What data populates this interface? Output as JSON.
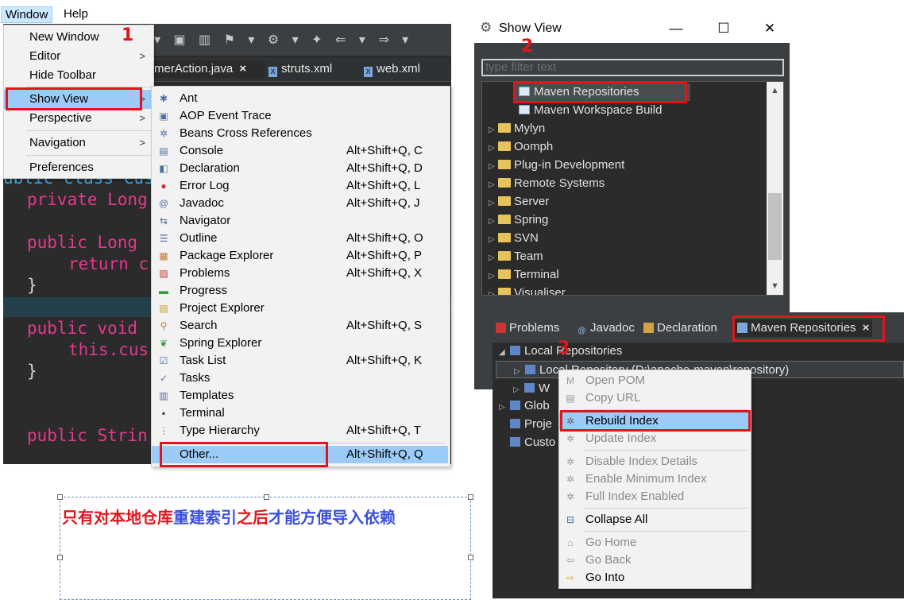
{
  "menubar": {
    "window": "Window",
    "help": "Help"
  },
  "window_menu": {
    "items": [
      {
        "label": "New Window"
      },
      {
        "label": "Editor",
        "submenu": true
      },
      {
        "label": "Hide Toolbar"
      },
      {
        "label": "Show View",
        "submenu": true,
        "selected": true
      },
      {
        "label": "Perspective",
        "submenu": true
      },
      {
        "label": "Navigation",
        "submenu": true
      },
      {
        "label": "Preferences"
      }
    ]
  },
  "editor": {
    "tabs": [
      "merAction.java",
      "struts.xml",
      "web.xml"
    ],
    "tab_close": "×",
    "code_lines": [
      "ublic class Cus",
      "private Long",
      "public Long",
      "return c",
      "}",
      "public void",
      "this.cus",
      "}",
      "public Strin"
    ]
  },
  "show_view_menu": {
    "items": [
      {
        "icon": "ant-icon",
        "glyph": "✱",
        "label": "Ant",
        "shortcut": ""
      },
      {
        "icon": "aop-trace-icon",
        "glyph": "▣",
        "label": "AOP Event Trace",
        "shortcut": ""
      },
      {
        "icon": "beans-icon",
        "glyph": "✲",
        "label": "Beans Cross References",
        "shortcut": ""
      },
      {
        "icon": "console-icon",
        "glyph": "▤",
        "label": "Console",
        "shortcut": "Alt+Shift+Q, C"
      },
      {
        "icon": "declaration-icon",
        "glyph": "◧",
        "label": "Declaration",
        "shortcut": "Alt+Shift+Q, D"
      },
      {
        "icon": "error-log-icon",
        "glyph": "●",
        "label": "Error Log",
        "shortcut": "Alt+Shift+Q, L"
      },
      {
        "icon": "javadoc-icon",
        "glyph": "@",
        "label": "Javadoc",
        "shortcut": "Alt+Shift+Q, J"
      },
      {
        "icon": "navigator-icon",
        "glyph": "⇆",
        "label": "Navigator",
        "shortcut": ""
      },
      {
        "icon": "outline-icon",
        "glyph": "☰",
        "label": "Outline",
        "shortcut": "Alt+Shift+Q, O"
      },
      {
        "icon": "package-explorer-icon",
        "glyph": "▦",
        "label": "Package Explorer",
        "shortcut": "Alt+Shift+Q, P"
      },
      {
        "icon": "problems-icon",
        "glyph": "▨",
        "label": "Problems",
        "shortcut": "Alt+Shift+Q, X"
      },
      {
        "icon": "progress-icon",
        "glyph": "▬",
        "label": "Progress",
        "shortcut": ""
      },
      {
        "icon": "project-explorer-icon",
        "glyph": "▧",
        "label": "Project Explorer",
        "shortcut": ""
      },
      {
        "icon": "search-icon",
        "glyph": "⚲",
        "label": "Search",
        "shortcut": "Alt+Shift+Q, S"
      },
      {
        "icon": "spring-explorer-icon",
        "glyph": "❦",
        "label": "Spring Explorer",
        "shortcut": ""
      },
      {
        "icon": "task-list-icon",
        "glyph": "☑",
        "label": "Task List",
        "shortcut": "Alt+Shift+Q, K"
      },
      {
        "icon": "tasks-icon",
        "glyph": "✓",
        "label": "Tasks",
        "shortcut": ""
      },
      {
        "icon": "templates-icon",
        "glyph": "▥",
        "label": "Templates",
        "shortcut": ""
      },
      {
        "icon": "terminal-icon",
        "glyph": "▪",
        "label": "Terminal",
        "shortcut": ""
      },
      {
        "icon": "type-hierarchy-icon",
        "glyph": "⋮",
        "label": "Type Hierarchy",
        "shortcut": "Alt+Shift+Q, T"
      },
      {
        "icon": "",
        "glyph": "",
        "label": "Other...",
        "shortcut": "Alt+Shift+Q, Q",
        "selected": true
      }
    ]
  },
  "steps": [
    "1",
    "2",
    "3"
  ],
  "note": {
    "red1": "只有对本地仓库",
    "blue1": "重建索引",
    "red2": "之后",
    "blue2": "才能方便导入依赖"
  },
  "show_view_dialog": {
    "title": "Show View",
    "filter_placeholder": "type filter text",
    "minimize": "—",
    "maximize": "☐",
    "close": "✕",
    "tree": [
      {
        "label": "Maven Repositories",
        "kind": "view",
        "selected": true
      },
      {
        "label": "Maven Workspace Build",
        "kind": "view"
      },
      {
        "label": "Mylyn",
        "kind": "folder"
      },
      {
        "label": "Oomph",
        "kind": "folder"
      },
      {
        "label": "Plug-in Development",
        "kind": "folder"
      },
      {
        "label": "Remote Systems",
        "kind": "folder"
      },
      {
        "label": "Server",
        "kind": "folder"
      },
      {
        "label": "Spring",
        "kind": "folder"
      },
      {
        "label": "SVN",
        "kind": "folder"
      },
      {
        "label": "Team",
        "kind": "folder"
      },
      {
        "label": "Terminal",
        "kind": "folder"
      },
      {
        "label": "Visualiser",
        "kind": "folder"
      }
    ]
  },
  "maven_view": {
    "tabs": [
      "Problems",
      "Javadoc",
      "Declaration",
      "Maven Repositories"
    ],
    "tab_close": "×",
    "rows": [
      {
        "label": "Local Repositories",
        "indent": 0,
        "open": true
      },
      {
        "label": "Local Repository (D:\\apache-maven\\repository)",
        "indent": 1,
        "highlight": true
      },
      {
        "label": "W",
        "indent": 1
      },
      {
        "label": "Glob",
        "indent": 0
      },
      {
        "label": "Proje",
        "indent": 0
      },
      {
        "label": "Custo",
        "indent": 0
      }
    ]
  },
  "context_menu": {
    "items": [
      {
        "label": "Open POM",
        "disabled": true,
        "icon": "pom-icon",
        "glyph": "M"
      },
      {
        "label": "Copy URL",
        "disabled": true,
        "icon": "copy-url-icon",
        "glyph": "▤"
      },
      {
        "label": "Rebuild Index",
        "disabled": false,
        "icon": "rebuild-index-icon",
        "glyph": "✲",
        "selected": true
      },
      {
        "label": "Update Index",
        "disabled": true,
        "icon": "update-index-icon",
        "glyph": "✲"
      },
      {
        "label": "Disable Index Details",
        "disabled": true,
        "icon": "disable-index-icon",
        "glyph": "✲"
      },
      {
        "label": "Enable Minimum Index",
        "disabled": true,
        "icon": "min-index-icon",
        "glyph": "✲"
      },
      {
        "label": "Full Index Enabled",
        "disabled": true,
        "icon": "full-index-icon",
        "glyph": "✲"
      },
      {
        "label": "Collapse All",
        "disabled": false,
        "icon": "collapse-all-icon",
        "glyph": "⊟"
      },
      {
        "label": "Go Home",
        "disabled": true,
        "icon": "go-home-icon",
        "glyph": "⌂"
      },
      {
        "label": "Go Back",
        "disabled": true,
        "icon": "go-back-icon",
        "glyph": "⇦"
      },
      {
        "label": "Go Into",
        "disabled": false,
        "icon": "go-into-icon",
        "glyph": "⇨"
      }
    ]
  },
  "colors": {
    "highlight_box": "#e3141c",
    "selection": "#9ccbf7",
    "dark_bg": "#2b2b2b"
  }
}
